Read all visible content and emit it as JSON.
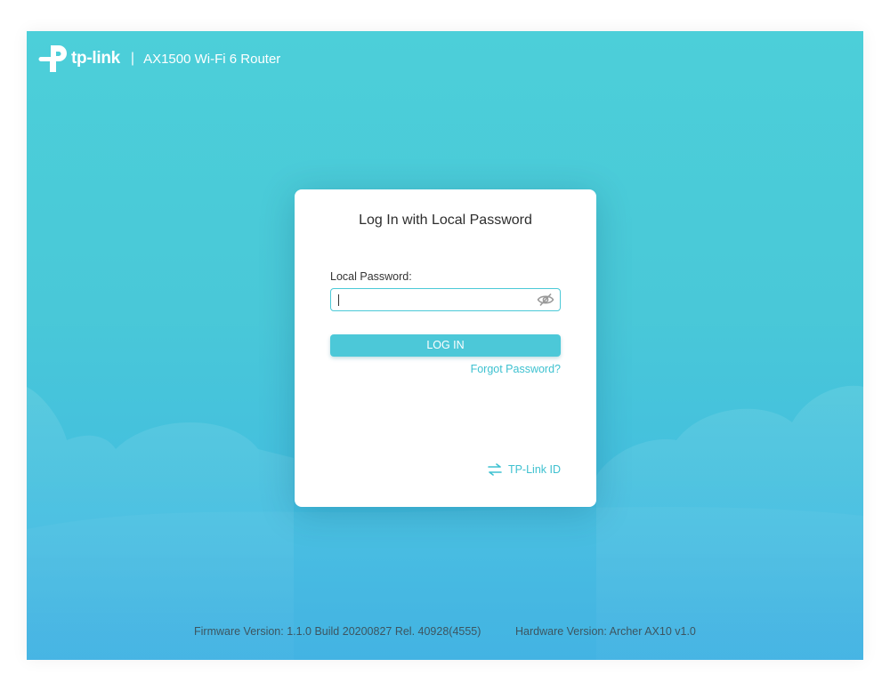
{
  "header": {
    "brand": "tp-link",
    "divider": "|",
    "model": "AX1500 Wi-Fi 6 Router"
  },
  "login": {
    "title": "Log In with Local Password",
    "password_label": "Local Password:",
    "password_value": "",
    "login_button": "LOG IN",
    "forgot_link": "Forgot Password?",
    "tplink_id_link": "TP-Link ID"
  },
  "footer": {
    "firmware": "Firmware Version: 1.1.0 Build 20200827 Rel. 40928(4555)",
    "hardware": "Hardware Version: Archer AX10 v1.0"
  },
  "icons": {
    "logo": "tp-link-logo-icon",
    "visibility": "eye-off-icon",
    "switch": "swap-arrows-icon"
  },
  "colors": {
    "accent": "#4cc8d8",
    "link": "#3ec1d0",
    "background_top": "#4ccfd9",
    "background_bottom": "#3cb0e2"
  }
}
